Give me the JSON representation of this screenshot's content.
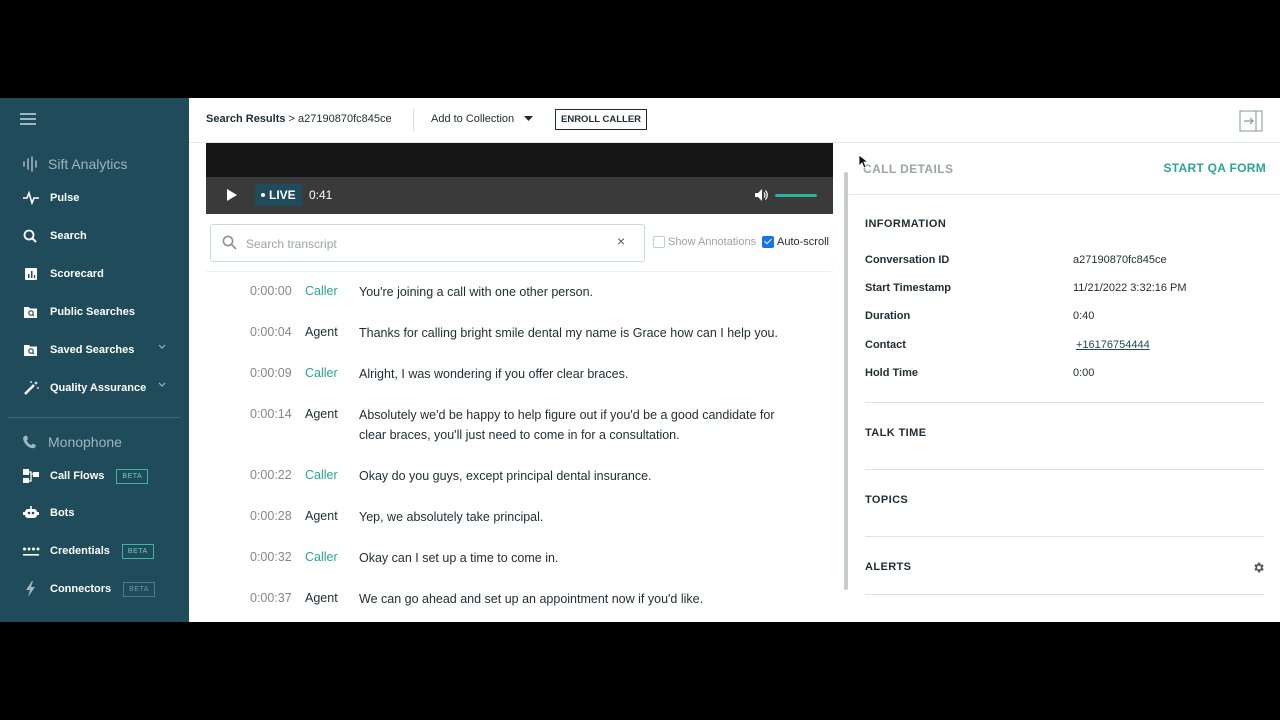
{
  "sidebar": {
    "analytics_title": "Sift Analytics",
    "items": [
      {
        "label": "Pulse",
        "icon": "pulse-icon"
      },
      {
        "label": "Search",
        "icon": "search-icon"
      },
      {
        "label": "Scorecard",
        "icon": "scorecard-icon"
      },
      {
        "label": "Public Searches",
        "icon": "public-search-icon"
      },
      {
        "label": "Saved Searches",
        "icon": "saved-search-icon"
      },
      {
        "label": "Quality Assurance",
        "icon": "magic-wand-icon"
      }
    ],
    "monophone_title": "Monophone",
    "items2": [
      {
        "label": "Call Flows",
        "icon": "call-flows-icon",
        "badge": "BETA"
      },
      {
        "label": "Bots",
        "icon": "bot-icon"
      },
      {
        "label": "Credentials",
        "icon": "credentials-icon",
        "badge": "BETA"
      },
      {
        "label": "Connectors",
        "icon": "lightning-icon",
        "badge": "BETA"
      }
    ]
  },
  "topbar": {
    "breadcrumb_root": "Search Results",
    "breadcrumb_sep": ">",
    "breadcrumb_id": "a27190870fc845ce",
    "add_to_collection": "Add to Collection",
    "enroll_caller": "ENROLL CALLER"
  },
  "player": {
    "live_label": "LIVE",
    "time": "0:41",
    "volume_level": 1.0
  },
  "transcript_search": {
    "placeholder": "Search transcript",
    "clear": "×",
    "show_annotations": "Show Annotations",
    "show_annotations_checked": false,
    "auto_scroll": "Auto-scroll",
    "auto_scroll_checked": true
  },
  "transcript": [
    {
      "time": "0:00:00",
      "speaker": "Caller",
      "text": "You're joining a call with one other person."
    },
    {
      "time": "0:00:04",
      "speaker": "Agent",
      "text": "Thanks for calling bright smile dental my name is Grace how can I help you."
    },
    {
      "time": "0:00:09",
      "speaker": "Caller",
      "text": "Alright, I was wondering if you offer clear braces."
    },
    {
      "time": "0:00:14",
      "speaker": "Agent",
      "text": "Absolutely we'd be happy to help figure out if you'd be a good candidate for clear braces, you'll just need to come in for a consultation."
    },
    {
      "time": "0:00:22",
      "speaker": "Caller",
      "text": "Okay do you guys, except principal dental insurance."
    },
    {
      "time": "0:00:28",
      "speaker": "Agent",
      "text": "Yep, we absolutely take principal."
    },
    {
      "time": "0:00:32",
      "speaker": "Caller",
      "text": "Okay can I set up a time to come in."
    },
    {
      "time": "0:00:37",
      "speaker": "Agent",
      "text": "We can go ahead and set up an appointment now if you'd like."
    }
  ],
  "details": {
    "title": "CALL DETAILS",
    "qa_form": "START QA FORM",
    "information_title": "INFORMATION",
    "fields": [
      {
        "key": "Conversation ID",
        "value": "a27190870fc845ce"
      },
      {
        "key": "Start Timestamp",
        "value": "11/21/2022 3:32:16 PM"
      },
      {
        "key": "Duration",
        "value": "0:40"
      },
      {
        "key": "Contact",
        "value": "+16176754444"
      },
      {
        "key": "Hold Time",
        "value": "0:00"
      }
    ],
    "talk_time_title": "TALK TIME",
    "topics_title": "TOPICS",
    "alerts_title": "ALERTS"
  },
  "colors": {
    "sidebar_bg": "#1f4b5a",
    "accent_teal": "#2aa691",
    "checkbox_blue": "#1a73e8"
  }
}
